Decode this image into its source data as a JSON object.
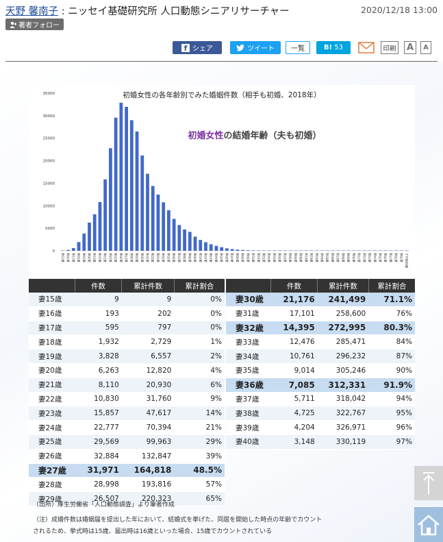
{
  "header": {
    "author": "天野 馨南子",
    "affiliation": " : ニッセイ基礎研究所 人口動態シニアリサーチャー",
    "date": "2020/12/18 13:00",
    "follow_label": "著者フォロー"
  },
  "share": {
    "facebook": "シェア",
    "twitter": "ツイート",
    "list": "一覧",
    "hatena_logo": "B!",
    "hatena_count": "53",
    "print": "印刷",
    "font_large": "A",
    "font_small": "A"
  },
  "chart_data": {
    "type": "bar",
    "title": "初婚女性の各年齢別でみた婚姻件数（相手も初婚、2018年）",
    "annotation": {
      "highlight": "初婚女性",
      "rest": "の結婚年齢（夫も初婚）"
    },
    "color": "#4169c8",
    "annotation_color": "#7b2fa0",
    "ylim": [
      0,
      35000
    ],
    "yticks": [
      "0",
      "5000",
      "10000",
      "15000",
      "20000",
      "25000",
      "30000",
      "35000"
    ],
    "categories": [
      "妻15歳",
      "妻16歳",
      "妻17歳",
      "妻18歳",
      "妻19歳",
      "妻20歳",
      "妻21歳",
      "妻22歳",
      "妻23歳",
      "妻24歳",
      "妻25歳",
      "妻26歳",
      "妻27歳",
      "妻28歳",
      "妻29歳",
      "妻30歳",
      "妻31歳",
      "妻32歳",
      "妻33歳",
      "妻34歳",
      "妻35歳",
      "妻36歳",
      "妻37歳",
      "妻38歳",
      "妻39歳",
      "妻40歳",
      "妻41歳",
      "妻42歳",
      "妻43歳",
      "妻44歳",
      "妻45歳",
      "妻46歳",
      "妻47歳",
      "妻48歳",
      "妻49歳",
      "妻50歳",
      "妻51歳",
      "妻52歳",
      "妻53歳",
      "妻54歳",
      "妻55歳",
      "妻56歳",
      "妻57歳",
      "妻58歳",
      "妻59歳",
      "妻60歳",
      "妻61歳",
      "妻62歳",
      "妻63歳",
      "妻64歳",
      "妻65歳",
      "妻66歳",
      "妻67歳",
      "妻68歳",
      "妻69歳",
      "妻70歳",
      "妻71歳",
      "妻72歳",
      "妻73歳",
      "妻74歳",
      "妻75歳",
      "妻76歳",
      "妻77歳",
      "妻78歳",
      "妻79歳",
      "妻80歳以上"
    ],
    "values": [
      9,
      193,
      595,
      1932,
      3828,
      6263,
      8110,
      10830,
      15857,
      22777,
      29569,
      32884,
      31971,
      28998,
      26507,
      21176,
      17101,
      14395,
      12476,
      10761,
      9014,
      7085,
      5711,
      4725,
      4204,
      3148,
      2400,
      1900,
      1450,
      1100,
      800,
      550,
      380,
      260,
      180,
      130,
      100,
      80,
      60,
      50,
      40,
      30,
      25,
      20,
      15,
      12,
      10,
      8,
      7,
      6,
      5,
      4,
      4,
      3,
      3,
      2,
      2,
      2,
      1,
      1,
      1,
      1,
      1,
      1,
      1,
      1
    ]
  },
  "table_left": {
    "headers": [
      "",
      "件数",
      "累計件数",
      "累計割合"
    ],
    "rows": [
      {
        "label": "妻15歳",
        "count": "9",
        "cum": "9",
        "pct": "0%",
        "hl": false
      },
      {
        "label": "妻16歳",
        "count": "193",
        "cum": "202",
        "pct": "0%",
        "hl": false
      },
      {
        "label": "妻17歳",
        "count": "595",
        "cum": "797",
        "pct": "0%",
        "hl": false
      },
      {
        "label": "妻18歳",
        "count": "1,932",
        "cum": "2,729",
        "pct": "1%",
        "hl": false
      },
      {
        "label": "妻19歳",
        "count": "3,828",
        "cum": "6,557",
        "pct": "2%",
        "hl": false
      },
      {
        "label": "妻20歳",
        "count": "6,263",
        "cum": "12,820",
        "pct": "4%",
        "hl": false
      },
      {
        "label": "妻21歳",
        "count": "8,110",
        "cum": "20,930",
        "pct": "6%",
        "hl": false
      },
      {
        "label": "妻22歳",
        "count": "10,830",
        "cum": "31,760",
        "pct": "9%",
        "hl": false
      },
      {
        "label": "妻23歳",
        "count": "15,857",
        "cum": "47,617",
        "pct": "14%",
        "hl": false
      },
      {
        "label": "妻24歳",
        "count": "22,777",
        "cum": "70,394",
        "pct": "21%",
        "hl": false
      },
      {
        "label": "妻25歳",
        "count": "29,569",
        "cum": "99,963",
        "pct": "29%",
        "hl": false
      },
      {
        "label": "妻26歳",
        "count": "32,884",
        "cum": "132,847",
        "pct": "39%",
        "hl": false
      },
      {
        "label": "妻27歳",
        "count": "31,971",
        "cum": "164,818",
        "pct": "48.5%",
        "hl": true
      },
      {
        "label": "妻28歳",
        "count": "28,998",
        "cum": "193,816",
        "pct": "57%",
        "hl": false
      },
      {
        "label": "妻29歳",
        "count": "26,507",
        "cum": "220,323",
        "pct": "65%",
        "hl": false
      }
    ]
  },
  "table_right": {
    "headers": [
      "",
      "件数",
      "累計件数",
      "累計割合"
    ],
    "rows": [
      {
        "label": "妻30歳",
        "count": "21,176",
        "cum": "241,499",
        "pct": "71.1%",
        "hl": true
      },
      {
        "label": "妻31歳",
        "count": "17,101",
        "cum": "258,600",
        "pct": "76%",
        "hl": false
      },
      {
        "label": "妻32歳",
        "count": "14,395",
        "cum": "272,995",
        "pct": "80.3%",
        "hl": true
      },
      {
        "label": "妻33歳",
        "count": "12,476",
        "cum": "285,471",
        "pct": "84%",
        "hl": false
      },
      {
        "label": "妻34歳",
        "count": "10,761",
        "cum": "296,232",
        "pct": "87%",
        "hl": false
      },
      {
        "label": "妻35歳",
        "count": "9,014",
        "cum": "305,246",
        "pct": "90%",
        "hl": false
      },
      {
        "label": "妻36歳",
        "count": "7,085",
        "cum": "312,331",
        "pct": "91.9%",
        "hl": true
      },
      {
        "label": "妻37歳",
        "count": "5,711",
        "cum": "318,042",
        "pct": "94%",
        "hl": false
      },
      {
        "label": "妻38歳",
        "count": "4,725",
        "cum": "322,767",
        "pct": "95%",
        "hl": false
      },
      {
        "label": "妻39歳",
        "count": "4,204",
        "cum": "326,971",
        "pct": "96%",
        "hl": false
      },
      {
        "label": "妻40歳",
        "count": "3,148",
        "cum": "330,119",
        "pct": "97%",
        "hl": false
      }
    ]
  },
  "source": "（出所）厚生労働省「人口動態調査」より筆者作成",
  "note": "（注）成婚件数は婚姻届を提出した年において、結婚式を挙げた、同居を開始した時点の年齢でカウントされるため、挙式時は15歳、届出時は16歳といった場合、15歳でカウントされている",
  "icons": {
    "to_top": "arrow-up-icon",
    "home": "home-icon"
  }
}
